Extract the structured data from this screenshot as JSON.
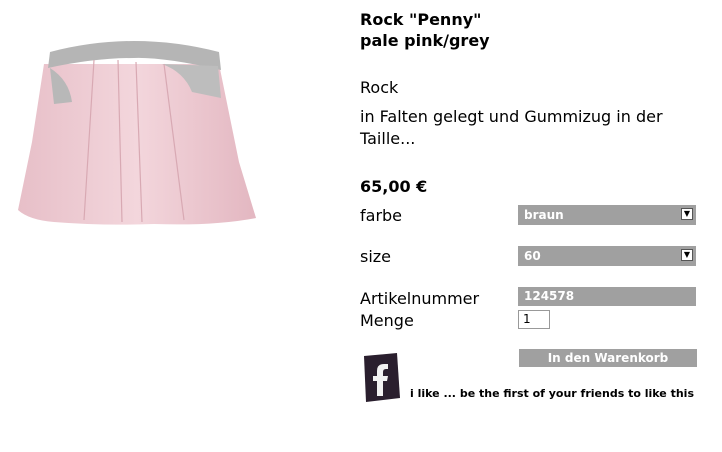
{
  "product": {
    "title_line1": "Rock \"Penny\"",
    "title_line2": "pale pink/grey",
    "type": "Rock",
    "description": "in Falten gelegt und Gummizug in der Taille...",
    "price": "65,00 €",
    "image_icon": "skirt-product-image"
  },
  "options": {
    "farbe_label": "farbe",
    "farbe_value": "braun",
    "size_label": "size",
    "size_value": "60",
    "artikelnummer_label": "Artikelnummer",
    "artikelnummer_value": "124578",
    "menge_label": "Menge",
    "menge_value": "1"
  },
  "actions": {
    "cart_button": "In den Warenkorb",
    "facebook_text": "i like ... be the first of your friends to like this",
    "facebook_icon": "facebook-icon"
  },
  "colors": {
    "select_bg": "#a0a0a0",
    "skirt_pink": "#f0cfd6",
    "waistband_grey": "#b5b5b5"
  }
}
